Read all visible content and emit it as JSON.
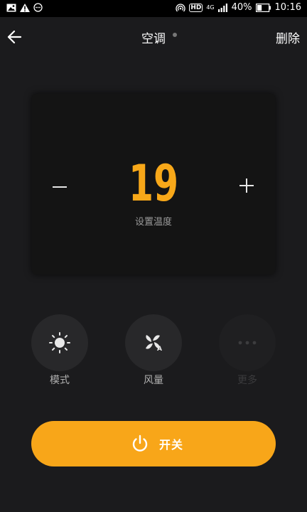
{
  "status_bar": {
    "network": "4G",
    "hd": "HD",
    "battery": "40%",
    "time": "10:16"
  },
  "header": {
    "title": "空调",
    "delete_label": "删除"
  },
  "thermostat": {
    "temperature": "19",
    "label": "设置温度"
  },
  "controls": [
    {
      "label": "模式",
      "icon": "sun-icon",
      "enabled": true
    },
    {
      "label": "风量",
      "icon": "fan-auto-icon",
      "enabled": true
    },
    {
      "label": "更多",
      "icon": "more-icon",
      "enabled": false
    }
  ],
  "power": {
    "label": "开关"
  },
  "colors": {
    "accent": "#f8a619",
    "background": "#1b1b1d",
    "card": "#141414"
  }
}
